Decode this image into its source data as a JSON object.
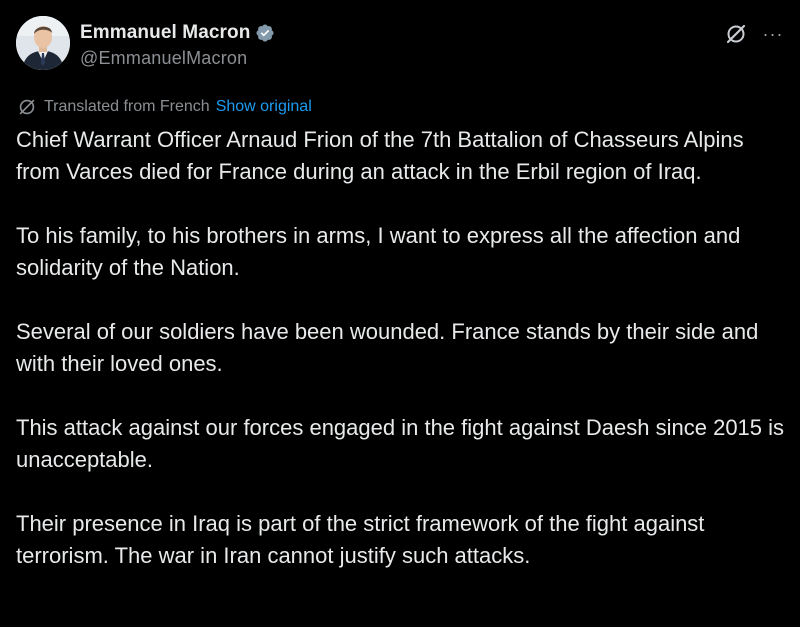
{
  "author": {
    "display_name": "Emmanuel Macron",
    "handle": "@EmmanuelMacron",
    "verified": true,
    "avatar_icon": "profile-photo"
  },
  "actions": {
    "grok_icon": "grok-icon",
    "more_icon": "more-icon",
    "more_glyph": "···"
  },
  "translation": {
    "label": "Translated from French",
    "show_original": "Show original",
    "icon": "translate-icon"
  },
  "tweet": {
    "paragraphs": [
      "Chief Warrant Officer Arnaud Frion of the 7th Battalion of Chasseurs Alpins from Varces died for France during an attack in the Erbil region of Iraq.",
      "To his family, to his brothers in arms, I want to express all the affection and solidarity of the Nation.",
      "Several of our soldiers have been wounded. France stands by their side and with their loved ones.",
      "This attack against our forces engaged in the fight against Daesh since 2015 is unacceptable.",
      "Their presence in Iraq is part of the strict framework of the fight against terrorism. The war in Iran cannot justify such attacks."
    ]
  },
  "colors": {
    "background": "#000000",
    "text": "#e7e9ea",
    "muted": "#8b8f93",
    "link": "#1d9bf0",
    "verified": "#829aab"
  }
}
